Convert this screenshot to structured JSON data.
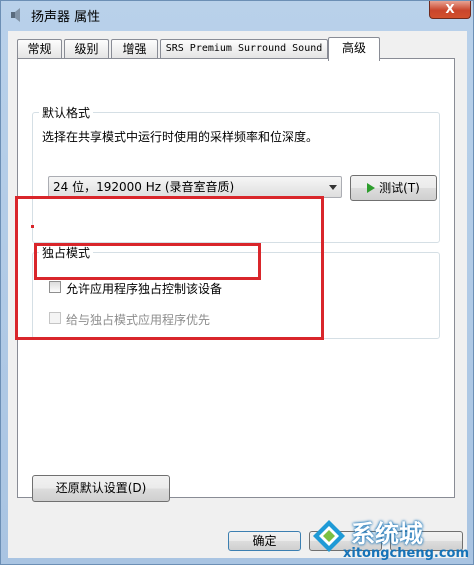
{
  "window": {
    "title": "扬声器 属性",
    "close_label": "X"
  },
  "tabs": [
    {
      "label": "常规"
    },
    {
      "label": "级别"
    },
    {
      "label": "增强"
    },
    {
      "label": "SRS Premium Surround Sound"
    },
    {
      "label": "高级",
      "active": true
    }
  ],
  "default_format": {
    "group_label": "默认格式",
    "description": "选择在共享模式中运行时使用的采样频率和位深度。",
    "selected_format": "24 位，192000 Hz (录音室音质)",
    "test_button": "测试(T)"
  },
  "exclusive_mode": {
    "group_label": "独占模式",
    "allow_exclusive_label": "允许应用程序独占控制该设备",
    "allow_exclusive_checked": false,
    "priority_label": "给与独占模式应用程序优先",
    "priority_checked": false,
    "priority_enabled": false
  },
  "restore_button": "还原默认设置(D)",
  "ok_button": "确定",
  "watermark": {
    "text": "系统城",
    "url": "xitongcheng.com"
  },
  "colors": {
    "highlight_red": "#d9262b",
    "watermark_blue": "#1673b8"
  }
}
